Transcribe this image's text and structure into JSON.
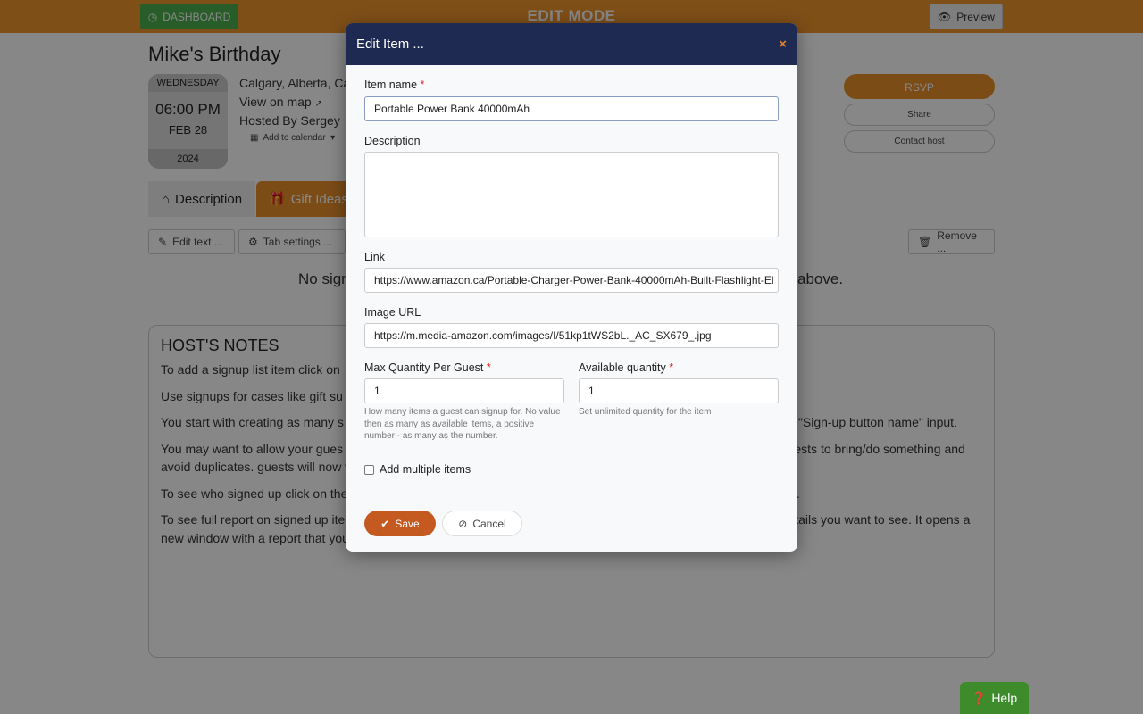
{
  "topbar": {
    "dashboard": "DASHBOARD",
    "mode": "EDIT MODE",
    "preview": "Preview",
    "accent": "#f0952f"
  },
  "event": {
    "title": "Mike's Birthday",
    "weekday": "WEDNESDAY",
    "time": "06:00 PM",
    "date": "FEB 28",
    "year": "2024",
    "location": "Calgary, Alberta, Ca",
    "map": "View on map",
    "hosted": "Hosted By  Sergey",
    "calendar": "Add to calendar"
  },
  "actions": {
    "rsvp": "RSVP",
    "share": "Share",
    "contact": "Contact host"
  },
  "tabs": [
    {
      "label": "Description",
      "icon": "home-icon"
    },
    {
      "label": "Gift Ideas",
      "icon": "gift-icon"
    }
  ],
  "toolbar": {
    "edit": "Edit text ...",
    "settings": "Tab settings ...",
    "remove": "Remove ..."
  },
  "empty": {
    "left": "No sign",
    "right": "above."
  },
  "notes": {
    "title": "HOST'S NOTES",
    "paragraphs": [
      "To add a signup list item click on",
      "Use signups for cases like gift su                                                                                                                                  e in a limited quantity, or a guest can take a limited quantity or it ne",
      "You start with creating as many s                                                                                                                                  select quanity if allowed and enter optional comment. You can                                                                                                                  new name into the \"Sign-up button name\" input.",
      "You may want to allow your gues                                                                                                                                 then select the \"Guests\" value for the \"Who can change function da                                                                                                                  nt to have guests to bring/do something and avoid duplicates.                                                                                                              guests will now what others already bringing and come up with something unique.",
      "To see who signed up click on the \"See who signed up for the item\" button under signup item name and description.",
      "To see full report on signed up items click on the \"🖨 Print\" dropdown button options and then select the level of details you want to see. It opens a new window with a report that you can also print."
    ]
  },
  "modal": {
    "title": "Edit Item ...",
    "close": "×",
    "item_name_label": "Item name",
    "item_name": "Portable Power Bank 40000mAh",
    "description_label": "Description",
    "description": "",
    "link_label": "Link",
    "link": "https://www.amazon.ca/Portable-Charger-Power-Bank-40000mAh-Built-Flashlight-El",
    "image_label": "Image URL",
    "image": "https://m.media-amazon.com/images/I/51kp1tWS2bL._AC_SX679_.jpg",
    "max_label": "Max Quantity Per Guest",
    "max": "1",
    "max_help": "How many items a guest can signup for. No value then as many as available items, a positive number - as many as the number.",
    "avail_label": "Available quantity",
    "avail": "1",
    "avail_help": "Set unlimited quantity for the item",
    "multiple_label": "Add multiple items",
    "multiple_checked": false,
    "save": "Save",
    "cancel": "Cancel",
    "required": "*"
  },
  "help": "Help"
}
